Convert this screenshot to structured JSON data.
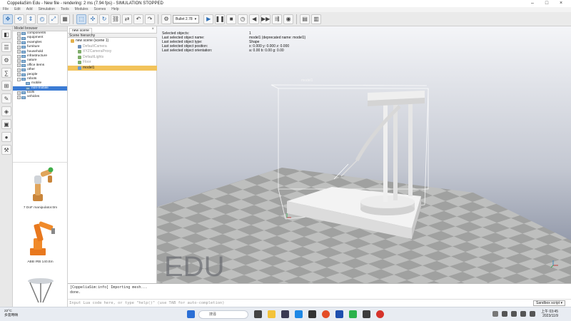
{
  "window": {
    "title": "CoppeliaSim Edu - New file - rendering: 2 ms (7.94 fps) - SIMULATION STOPPED"
  },
  "menu": [
    "File",
    "Edit",
    "Add",
    "Simulation",
    "Tools",
    "Modules",
    "Scenes",
    "Help"
  ],
  "toolbar": {
    "engine": "Bullet 2.78"
  },
  "model_browser": {
    "header": "Model browser",
    "items": [
      {
        "label": "components",
        "indent": 1
      },
      {
        "label": "equipment",
        "indent": 1
      },
      {
        "label": "examples",
        "indent": 1
      },
      {
        "label": "furniture",
        "indent": 1
      },
      {
        "label": "household",
        "indent": 1
      },
      {
        "label": "infrastructure",
        "indent": 1
      },
      {
        "label": "nature",
        "indent": 1
      },
      {
        "label": "office items",
        "indent": 1
      },
      {
        "label": "other",
        "indent": 1
      },
      {
        "label": "people",
        "indent": 1
      },
      {
        "label": "robots",
        "indent": 1
      },
      {
        "label": "mobile",
        "indent": 2
      },
      {
        "label": "non-mobile",
        "indent": 2,
        "selected": true
      },
      {
        "label": "tools",
        "indent": 1
      },
      {
        "label": "vehicles",
        "indent": 1
      }
    ],
    "thumbs": [
      {
        "label": "7 DoF manipulator.ttm"
      },
      {
        "label": "ABB IRB 140.ttm"
      }
    ]
  },
  "scene_hierarchy": {
    "tab": "new scene",
    "header": "Scene hierarchy",
    "items": [
      {
        "label": "new scene (scene 1)",
        "indent": 0,
        "dim": false,
        "icon_color": "#e3b04b"
      },
      {
        "label": "DefaultCamera",
        "indent": 1,
        "dim": true,
        "icon_color": "#6b8fb8"
      },
      {
        "label": "XYZCameraProxy",
        "indent": 1,
        "dim": true,
        "icon_color": "#7fae6a"
      },
      {
        "label": "DefaultLights",
        "indent": 1,
        "dim": true,
        "icon_color": "#7fae6a"
      },
      {
        "label": "Floor",
        "indent": 1,
        "dim": true,
        "icon_color": "#7fae6a"
      },
      {
        "label": "model1",
        "indent": 1,
        "dim": false,
        "selected": true,
        "icon_color": "#6b9bd1"
      }
    ]
  },
  "viewport": {
    "info_labels": [
      "Selected objects:",
      "Last selected object name:",
      "Last selected object type:",
      "Last selected object position:",
      "Last selected object orientation:"
    ],
    "info_values": [
      "1",
      "model1    (deprecated name: model1)",
      "Shape",
      "x: 0.000   y: 0.000   z: 0.000",
      "a: 0.00   b: 0.00   g: 0.00"
    ],
    "object_label": "model1",
    "watermark": "EDU",
    "colors": {
      "sky_top": "#f4f5f8",
      "sky_bottom": "#7a8296",
      "floor_light": "#c9cac9",
      "floor_dark": "#a9aaa9"
    }
  },
  "console": {
    "lines": [
      "[CoppeliaSim:info] Importing mesh...",
      "done."
    ],
    "input_placeholder": "Input Lua code here, or type \"help()\" (use TAB for auto-completion)",
    "script_selector": "Sandbox script"
  },
  "taskbar": {
    "weather_temp": "22°C",
    "weather_desc": "多雲時晴",
    "search_placeholder": "搜尋",
    "time": "上午 03:45",
    "date": "2023/11/9"
  }
}
